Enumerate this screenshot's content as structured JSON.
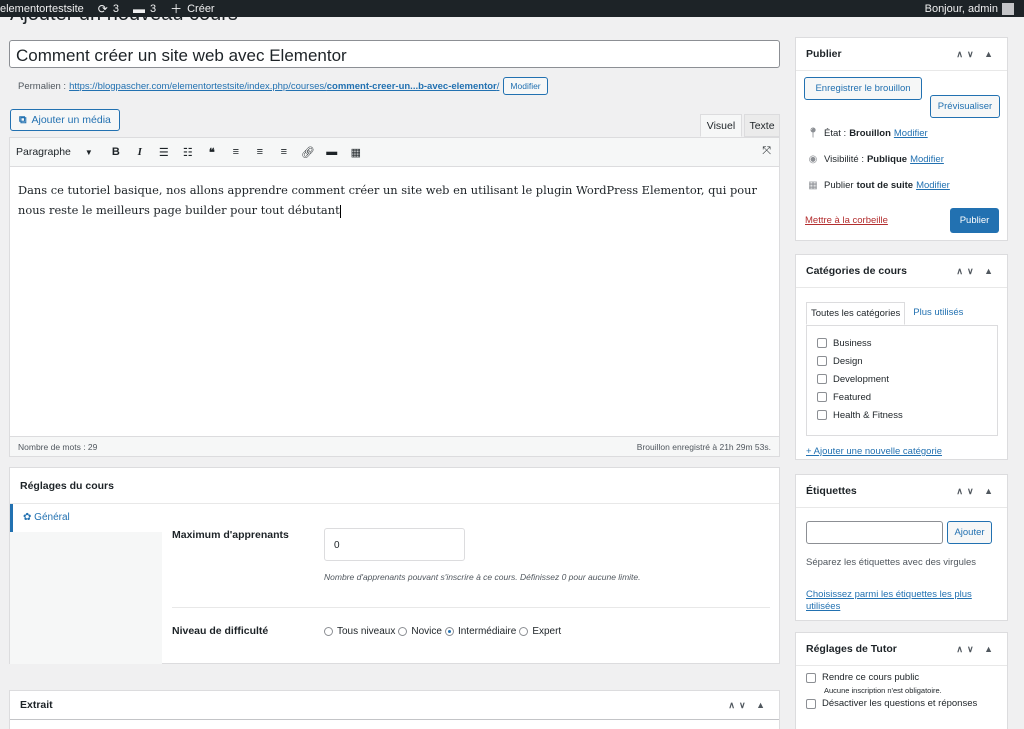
{
  "adminbar": {
    "site_name": "elementortestsite",
    "updates_count": "3",
    "comments_count": "3",
    "create_label": "Créer",
    "greeting": "Bonjour, admin"
  },
  "page": {
    "title": "Ajouter un nouveau cours"
  },
  "post": {
    "title": "Comment créer un site web avec Elementor",
    "permalink_label": "Permalien :",
    "permalink_url": "https://blogpascher.com/elementortestsite/index.php/courses/",
    "permalink_slug": "comment-creer-un...b-avec-elementor",
    "permalink_trail": "/",
    "permalink_edit": "Modifier"
  },
  "editor": {
    "add_media": "Ajouter un média",
    "tab_visual": "Visuel",
    "tab_text": "Texte",
    "format_select": "Paragraphe",
    "content": "Dans ce tutoriel basique, nos allons apprendre comment créer un site web en utilisant le plugin WordPress Elementor, qui pour nous reste le meilleurs page builder pour tout débutant",
    "word_count": "Nombre de mots : 29",
    "draft_saved": "Brouillon enregistré à 21h 29m 53s."
  },
  "course_settings": {
    "title": "Réglages du cours",
    "tab_general": "Général",
    "max_students_label": "Maximum d'apprenants",
    "max_students_value": "0",
    "max_students_hint": "Nombre d'apprenants pouvant s'inscrire à ce cours. Définissez 0 pour aucune limite.",
    "difficulty_label": "Niveau de difficulté",
    "difficulty_options": [
      "Tous niveaux",
      "Novice",
      "Intermédiaire",
      "Expert"
    ],
    "difficulty_selected": "Intermédiaire"
  },
  "excerpt": {
    "title": "Extrait"
  },
  "publish": {
    "title": "Publier",
    "save_draft": "Enregistrer le brouillon",
    "preview": "Prévisualiser",
    "status_label": "État :",
    "status_value": "Brouillon",
    "visibility_label": "Visibilité :",
    "visibility_value": "Publique",
    "schedule_label": "Publier",
    "schedule_value": "tout de suite",
    "edit": "Modifier",
    "trash": "Mettre à la corbeille",
    "publish_button": "Publier"
  },
  "categories": {
    "title": "Catégories de cours",
    "tab_all": "Toutes les catégories",
    "tab_popular": "Plus utilisés",
    "items": [
      "Business",
      "Design",
      "Development",
      "Featured",
      "Health & Fitness"
    ],
    "add_new": "+ Ajouter une nouvelle catégorie"
  },
  "tags": {
    "title": "Étiquettes",
    "add_button": "Ajouter",
    "note": "Séparez les étiquettes avec des virgules",
    "choose_link": "Choisissez parmi les étiquettes les plus utilisées"
  },
  "tutor": {
    "title": "Réglages de Tutor",
    "public_label": "Rendre ce cours public",
    "public_note": "Aucune inscription n'est obligatoire.",
    "disable_qa_label": "Désactiver les questions et réponses"
  },
  "colors": {
    "accent": "#2271b1",
    "adminbar": "#1d2327",
    "trash": "#b32d2e"
  }
}
